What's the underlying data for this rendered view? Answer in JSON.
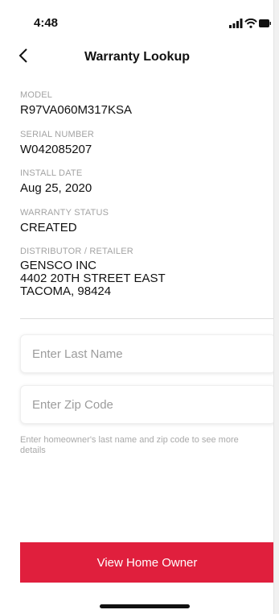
{
  "status_bar": {
    "time": "4:48"
  },
  "nav": {
    "title": "Warranty Lookup"
  },
  "details": {
    "model_label": "MODEL",
    "model_value": "R97VA060M317KSA",
    "serial_label": "SERIAL NUMBER",
    "serial_value": "W042085207",
    "install_label": "INSTALL DATE",
    "install_value": "Aug 25, 2020",
    "status_label": "WARRANTY STATUS",
    "status_value": "CREATED",
    "distributor_label": "DISTRIBUTOR / RETAILER",
    "distributor_lines": [
      "GENSCO INC",
      "4402 20TH STREET EAST",
      "TACOMA, 98424"
    ]
  },
  "form": {
    "last_name_placeholder": "Enter Last Name",
    "last_name_value": "",
    "zip_placeholder": "Enter Zip Code",
    "zip_value": "",
    "helper_text": "Enter homeowner's last name and zip code to see more details"
  },
  "actions": {
    "view_owner_label": "View Home Owner"
  },
  "colors": {
    "accent": "#e01f3d",
    "label_gray": "#a3a3a3",
    "text": "#111111"
  },
  "icons": [
    "signal-icon",
    "wifi-icon",
    "battery-icon",
    "back-chevron-icon"
  ]
}
